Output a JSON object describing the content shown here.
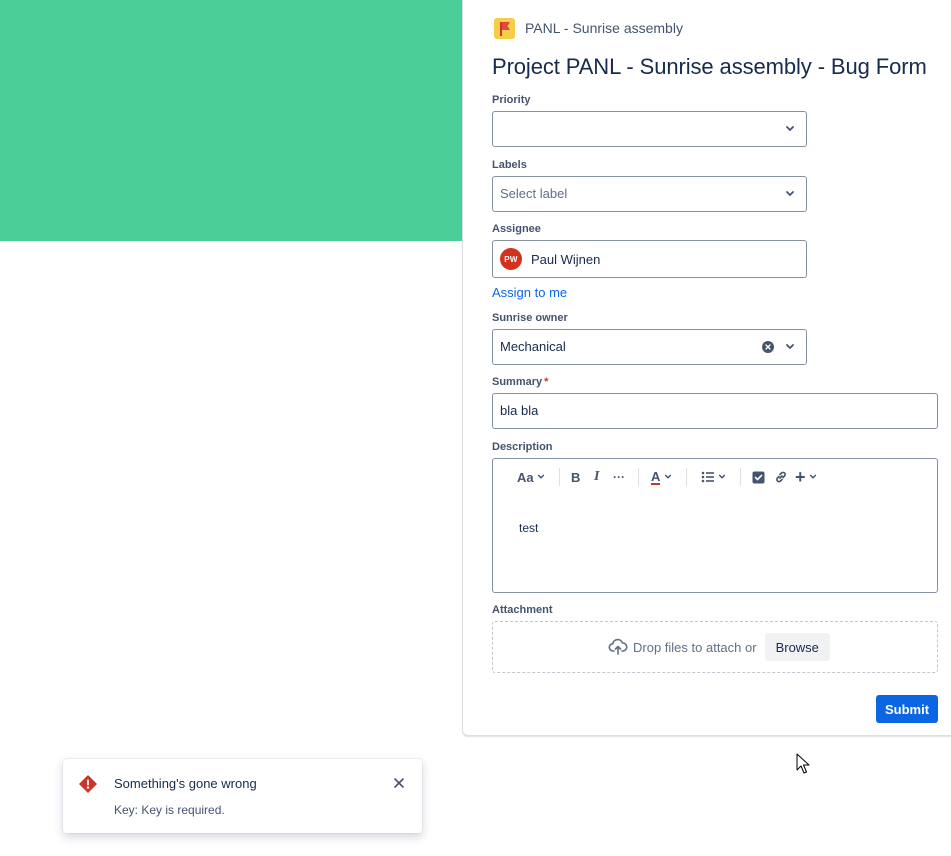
{
  "project": {
    "icon": "project-flag-icon",
    "name": "PANL - Sunrise assembly"
  },
  "form": {
    "title": "Project PANL - Sunrise assembly - Bug Form",
    "priority": {
      "label": "Priority",
      "value": ""
    },
    "labels": {
      "label": "Labels",
      "placeholder": "Select label"
    },
    "assignee": {
      "label": "Assignee",
      "initials": "PW",
      "name": "Paul Wijnen",
      "assign_to_me": "Assign to me"
    },
    "sunrise_owner": {
      "label": "Sunrise owner",
      "value": "Mechanical"
    },
    "summary": {
      "label": "Summary",
      "required_mark": "*",
      "value": "bla bla"
    },
    "description": {
      "label": "Description",
      "toolbar": {
        "text_style": "Aa",
        "bold": "B",
        "italic": "I",
        "more": "···",
        "text_color": "A",
        "list": "list-icon",
        "checkbox": "task-checkbox-icon",
        "link": "link-icon",
        "insert": "+"
      },
      "content": "test"
    },
    "attachment": {
      "label": "Attachment",
      "drop_text": "Drop files to attach or",
      "browse_label": "Browse"
    },
    "submit_label": "Submit"
  },
  "error_flag": {
    "title": "Something's gone wrong",
    "message": "Key: Key is required."
  },
  "colors": {
    "banner": "#4bce97",
    "primary": "#0c66e4",
    "error": "#c9372c",
    "avatar": "#d2331c"
  }
}
